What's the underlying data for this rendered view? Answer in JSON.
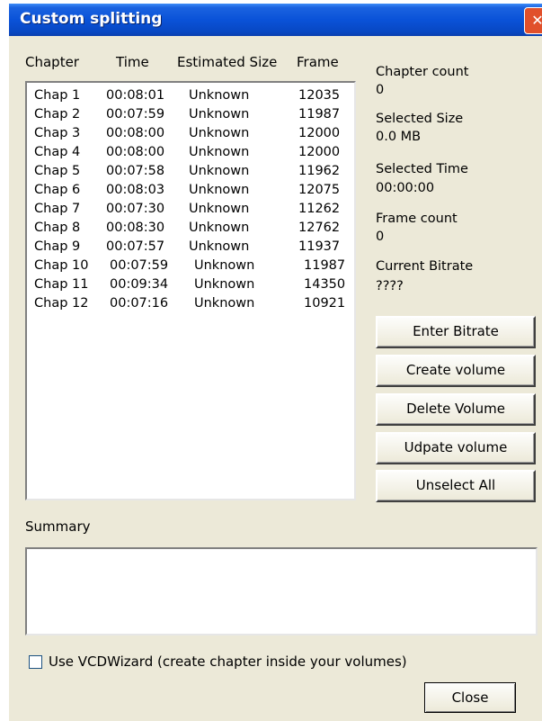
{
  "window": {
    "title": "Custom splitting",
    "close_glyph": "✕"
  },
  "chapters_list": {
    "headers": [
      "Chapter",
      "Time",
      "Estimated Size",
      "Frame"
    ],
    "rows": [
      {
        "chapter": "Chap 1",
        "time": "00:08:01",
        "size": "Unknown",
        "frame": "12035"
      },
      {
        "chapter": "Chap 2",
        "time": "00:07:59",
        "size": "Unknown",
        "frame": "11987"
      },
      {
        "chapter": "Chap 3",
        "time": "00:08:00",
        "size": "Unknown",
        "frame": "12000"
      },
      {
        "chapter": "Chap 4",
        "time": "00:08:00",
        "size": "Unknown",
        "frame": "12000"
      },
      {
        "chapter": "Chap 5",
        "time": "00:07:58",
        "size": "Unknown",
        "frame": "11962"
      },
      {
        "chapter": "Chap 6",
        "time": "00:08:03",
        "size": "Unknown",
        "frame": "12075"
      },
      {
        "chapter": "Chap 7",
        "time": "00:07:30",
        "size": "Unknown",
        "frame": "11262"
      },
      {
        "chapter": "Chap 8",
        "time": "00:08:30",
        "size": "Unknown",
        "frame": "12762"
      },
      {
        "chapter": "Chap 9",
        "time": "00:07:57",
        "size": "Unknown",
        "frame": "11937"
      },
      {
        "chapter": "Chap 10",
        "time": "00:07:59",
        "size": "Unknown",
        "frame": "11987"
      },
      {
        "chapter": "Chap 11",
        "time": "00:09:34",
        "size": "Unknown",
        "frame": "14350"
      },
      {
        "chapter": "Chap 12",
        "time": "00:07:16",
        "size": "Unknown",
        "frame": "10921"
      }
    ]
  },
  "info": {
    "chapter_count_label": "Chapter count",
    "chapter_count_value": "0",
    "selected_size_label": "Selected Size",
    "selected_size_value": "0.0 MB",
    "selected_time_label": "Selected Time",
    "selected_time_value": "00:00:00",
    "frame_count_label": "Frame count",
    "frame_count_value": "0",
    "current_bitrate_label": "Current Bitrate",
    "current_bitrate_value": "????"
  },
  "buttons": {
    "enter_bitrate": "Enter Bitrate",
    "create_volume": "Create volume",
    "delete_volume": "Delete Volume",
    "update_volume": "Udpate volume",
    "unselect_all": "Unselect All",
    "close": "Close"
  },
  "summary": {
    "label": "Summary",
    "text": ""
  },
  "vcdwizard": {
    "label": "Use VCDWizard (create chapter inside your volumes)",
    "checked": false
  }
}
